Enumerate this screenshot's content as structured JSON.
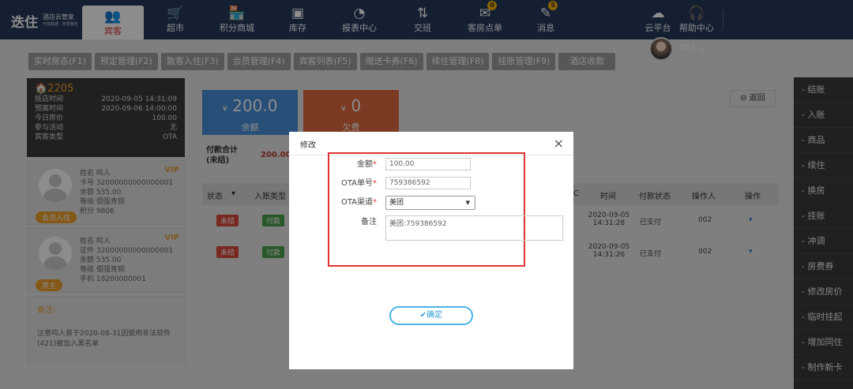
{
  "app": {
    "logo_text": "迭住",
    "logo_sub": "酒店云管家",
    "logo_tiny": "开放数据 · 智慧服务"
  },
  "nav": [
    {
      "label": "宾客",
      "icon": "guests-icon",
      "active": true
    },
    {
      "label": "超市",
      "icon": "cart-icon"
    },
    {
      "label": "积分商城",
      "icon": "shop-icon"
    },
    {
      "label": "库存",
      "icon": "box-icon"
    },
    {
      "label": "报表中心",
      "icon": "chart-icon"
    },
    {
      "label": "交班",
      "icon": "swap-icon"
    },
    {
      "label": "客房点单",
      "icon": "order-icon",
      "badge": "0"
    },
    {
      "label": "消息",
      "icon": "message-icon",
      "badge": "5"
    },
    {
      "label": "云平台",
      "icon": "cloud-icon"
    },
    {
      "label": "帮助中心",
      "icon": "headset-icon"
    }
  ],
  "user": {
    "name": "002"
  },
  "tabs": [
    "实时房态(F1)",
    "预定管理(F2)",
    "散客入住(F3)",
    "会员管理(F4)",
    "宾客列表(F5)",
    "赠送卡券(F6)",
    "续住管理(F8)",
    "挂账管理(F9)",
    "酒店收款"
  ],
  "room": {
    "number": "2205",
    "rows": [
      {
        "k": "抵店时间",
        "v": "2020-09-05 14:31:09"
      },
      {
        "k": "预离时间",
        "v": "2020-09-06 14:00:00"
      },
      {
        "k": "今日房价",
        "v": "100.00"
      },
      {
        "k": "参与活动",
        "v": "无"
      },
      {
        "k": "宾客类型",
        "v": "OTA"
      }
    ]
  },
  "guests": [
    {
      "tag": "会员入住",
      "vip": "VIP",
      "lines": [
        "姓名  鸣人",
        "卡号  32000000000000001",
        "余额  535.00",
        "等级  倔强青铜",
        "积分  9806"
      ]
    },
    {
      "tag": "房主",
      "vip": "VIP",
      "lines": [
        "姓名  鸣人",
        "证件  32000000000000001",
        "余额  535.00",
        "等级  倔强青铜",
        "手机  18200000001"
      ]
    }
  ],
  "note": {
    "title": "备注:",
    "content": "注意鸣人曾于2020-08-31因使用非法软件(421)被加入黑名单"
  },
  "cards": {
    "balance": {
      "currency": "¥",
      "amount": "200.0",
      "label": "余额"
    },
    "debt": {
      "currency": "¥",
      "amount": "0",
      "label": "欠费"
    }
  },
  "summary": {
    "label": "付款合计\n(未结)",
    "value": "200.00"
  },
  "back_label": "返回",
  "table": {
    "headers": [
      "状态",
      "入账类型",
      "C",
      "时间",
      "付款状态",
      "操作人",
      "操作"
    ],
    "rows": [
      {
        "status": "未结",
        "type": "付款",
        "time": "2020-09-05\n14:31:28",
        "pay": "已支付",
        "op": "002"
      },
      {
        "status": "未结",
        "type": "付款",
        "time": "2020-09-05\n14:31:26",
        "pay": "已支付",
        "op": "002"
      }
    ]
  },
  "right_menu": [
    "- 结账",
    "- 入账",
    "- 商品",
    "- 续住",
    "- 换房",
    "- 挂账",
    "- 冲调",
    "- 房费券",
    "- 修改房价",
    "- 临时挂起",
    "- 增加同住",
    "- 制作新卡"
  ],
  "modal": {
    "title": "修改",
    "fields": {
      "amount": {
        "label": "金额",
        "value": "100.00"
      },
      "ota_no": {
        "label": "OTA单号",
        "value": "759386592"
      },
      "channel": {
        "label": "OTA渠道",
        "value": "美团"
      },
      "remark": {
        "label": "备注",
        "value": "美团:759386592"
      }
    },
    "ok_label": "✔确定"
  },
  "colors": {
    "topbar": "#263a5c",
    "accent_red": "#e0322c",
    "balance_card": "#4a90d9",
    "debt_card": "#e06b3c",
    "highlight": "#e03434"
  }
}
